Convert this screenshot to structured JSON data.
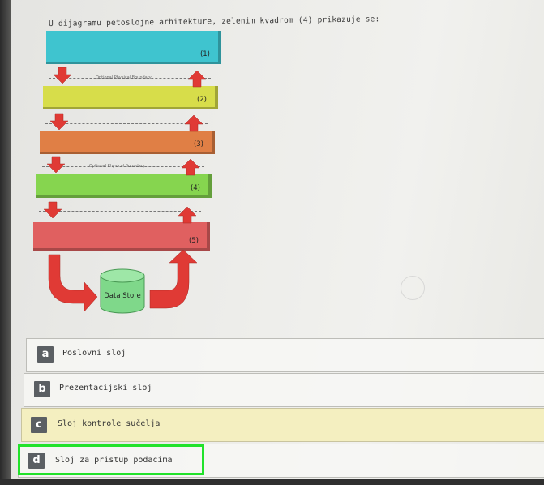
{
  "question": "U dijagramu petoslojne arhitekture, zelenim kvadrom (4) prikazuje se:",
  "diagram": {
    "layers": [
      {
        "label": "(1)",
        "color": "#3fc4cf"
      },
      {
        "label": "(2)",
        "color": "#d7dd4a"
      },
      {
        "label": "(3)",
        "color": "#e07f45"
      },
      {
        "label": "(4)",
        "color": "#86d54f"
      },
      {
        "label": "(5)",
        "color": "#e06060"
      }
    ],
    "boundary_label": "Optional Physical Boundary",
    "data_store_label": "Data Store",
    "colors": {
      "arrow": "#e03a35",
      "data_store": "#7fd88a"
    }
  },
  "options": [
    {
      "letter": "a",
      "text": "Poslovni sloj"
    },
    {
      "letter": "b",
      "text": "Prezentacijski sloj"
    },
    {
      "letter": "c",
      "text": "Sloj kontrole sučelja"
    },
    {
      "letter": "d",
      "text": "Sloj za pristup podacima"
    }
  ],
  "highlight_color": "#22e22b"
}
